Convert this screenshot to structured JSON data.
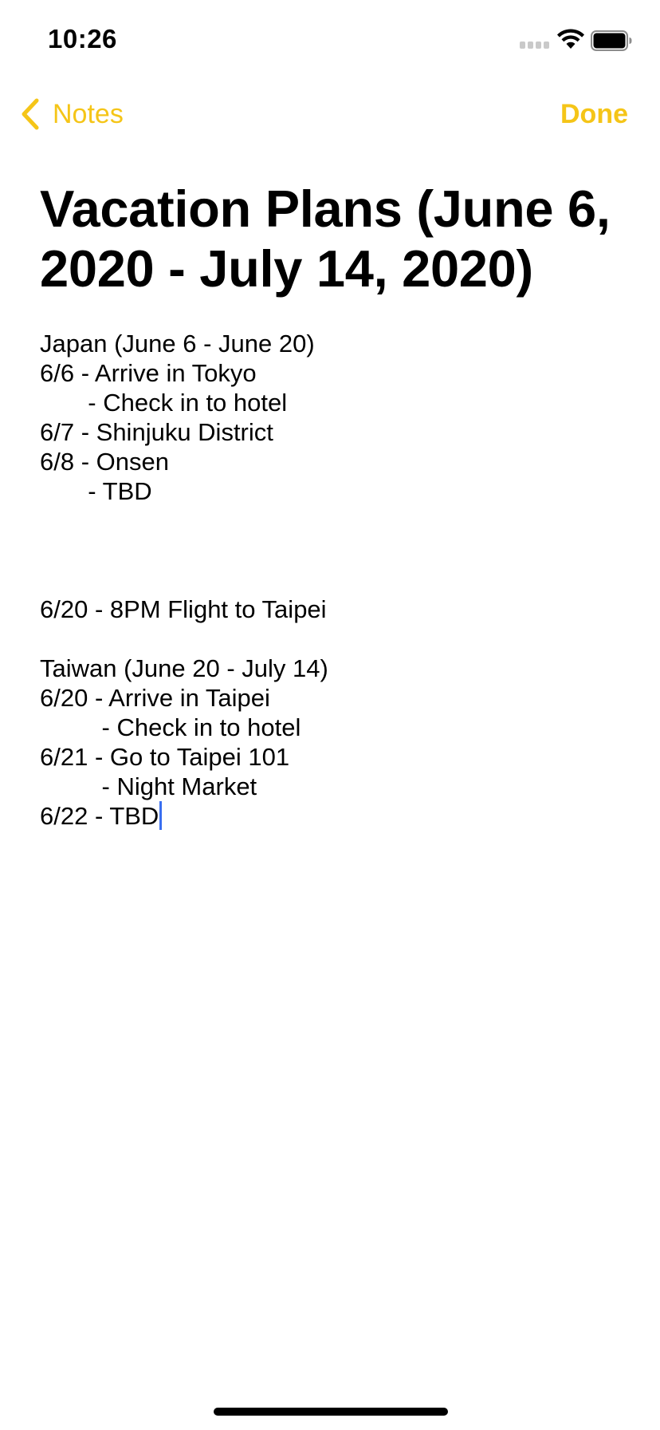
{
  "status_bar": {
    "time": "10:26",
    "icons": [
      "cellular-signal-icon",
      "wifi-icon",
      "battery-icon"
    ]
  },
  "nav": {
    "back_label": "Notes",
    "done_label": "Done",
    "accent_color": "#f5c518"
  },
  "note": {
    "title": "Vacation Plans (June 6, 2020 - July 14, 2020)",
    "lines": [
      "Japan (June 6 - June 20)",
      "6/6 - Arrive in Tokyo",
      "       - Check in to hotel",
      "6/7 - Shinjuku District",
      "6/8 - Onsen",
      "       - TBD",
      "",
      "",
      "",
      "6/20 - 8PM Flight to Taipei",
      "",
      "Taiwan (June 20 - July 14)",
      "6/20 - Arrive in Taipei",
      "         - Check in to hotel",
      "6/21 - Go to Taipei 101",
      "         - Night Market",
      "6/22 - TBD"
    ],
    "caret_color": "#3a6ff0"
  }
}
